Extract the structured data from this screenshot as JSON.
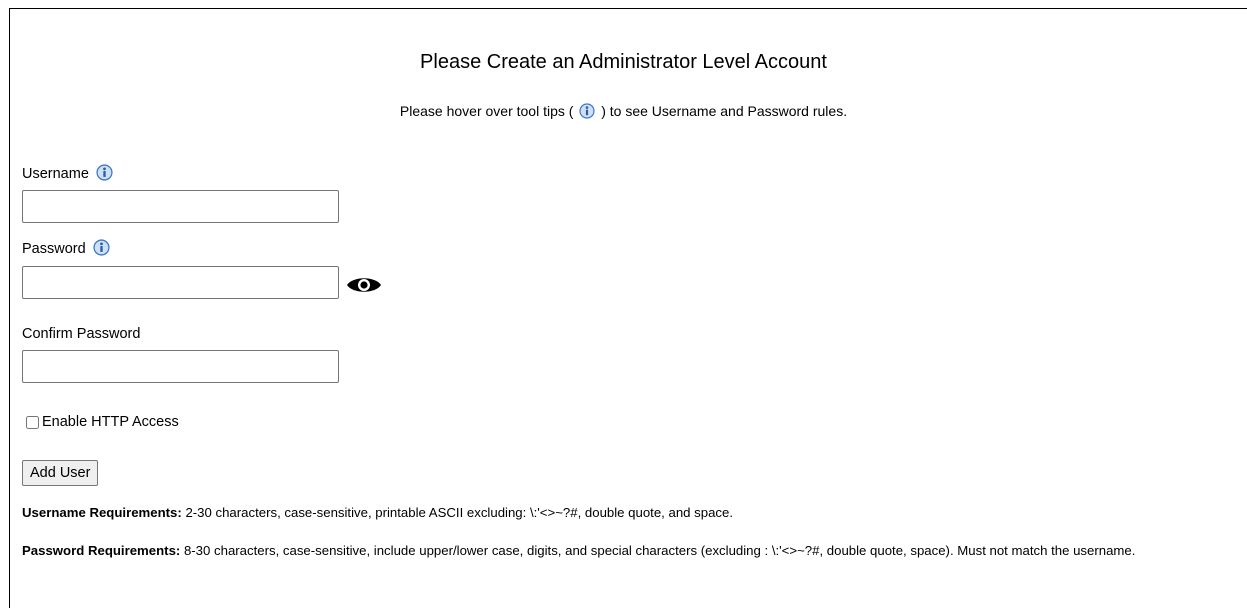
{
  "heading": "Please Create an Administrator Level Account",
  "subheading": {
    "before": "Please hover over tool tips (",
    "after": ") to see Username and Password rules."
  },
  "username": {
    "label": "Username",
    "value": ""
  },
  "password": {
    "label": "Password",
    "value": ""
  },
  "confirm_password": {
    "label": "Confirm Password",
    "value": ""
  },
  "http_access": {
    "label": "Enable HTTP Access",
    "checked": false
  },
  "add_user_label": "Add User",
  "username_requirements": {
    "title": "Username Requirements:",
    "text": " 2-30 characters, case-sensitive, printable ASCII excluding: \\:'<>~?#, double quote, and space."
  },
  "password_requirements": {
    "title": "Password Requirements:",
    "text": " 8-30 characters, case-sensitive, include upper/lower case, digits, and special characters (excluding : \\:'<>~?#, double quote, space). Must not match the username."
  },
  "icons": {
    "tooltip": "info-icon",
    "show_password": "eye-icon"
  },
  "colors": {
    "info_icon": "#3b78c6",
    "eye_icon": "#000000"
  }
}
